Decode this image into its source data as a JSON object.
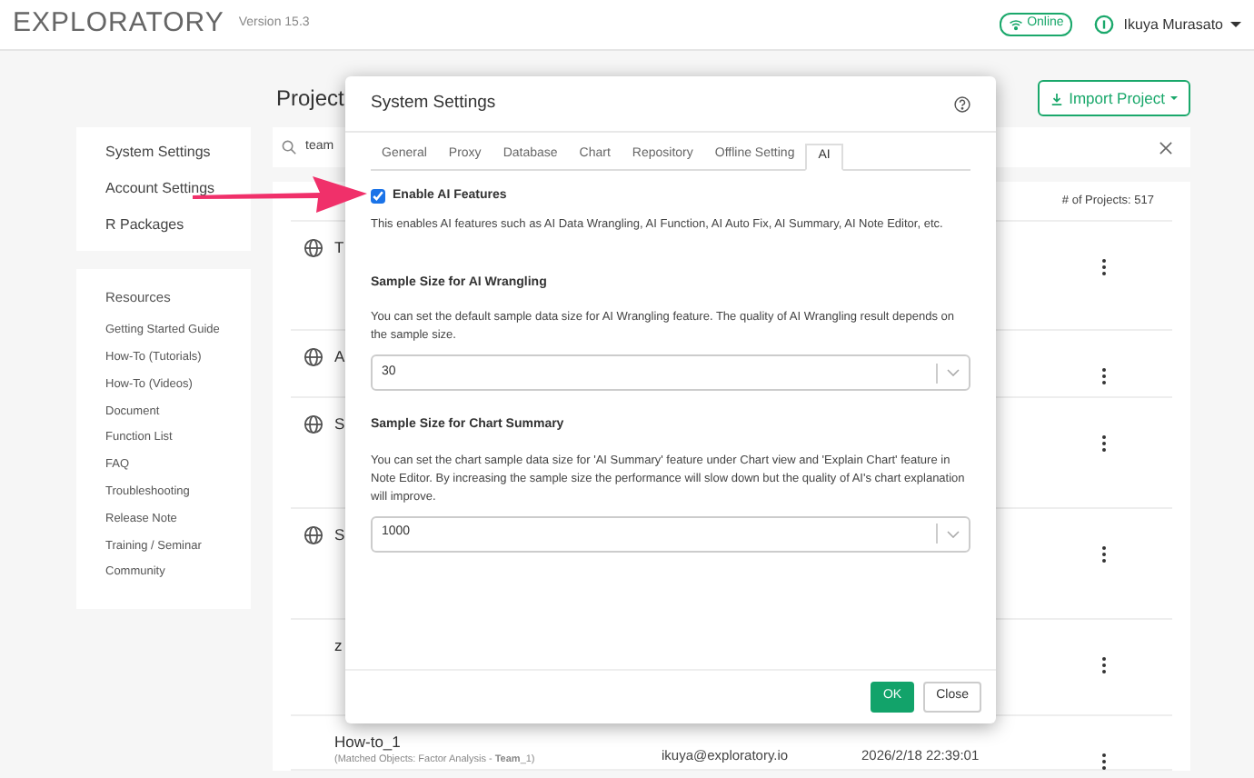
{
  "header": {
    "logo": "EXPLORATORY",
    "version": "Version 15.3",
    "status": "Online",
    "user": "Ikuya Murasato"
  },
  "settings_menu": [
    {
      "label": "System Settings"
    },
    {
      "label": "Account Settings"
    },
    {
      "label": "R Packages"
    }
  ],
  "resources": {
    "title": "Resources",
    "items": [
      "Getting Started Guide",
      "How-To (Tutorials)",
      "How-To (Videos)",
      "Document",
      "Function List",
      "FAQ",
      "Troubleshooting",
      "Release Note",
      "Training / Seminar",
      "Community"
    ]
  },
  "page": {
    "title": "Project",
    "import_button": "Import Project",
    "search": {
      "value": "team"
    },
    "project_count": "# of Projects: 517"
  },
  "projects": [
    {
      "title": "T",
      "kind": "public"
    },
    {
      "title": "A",
      "kind": "public"
    },
    {
      "title": "S",
      "kind": "public"
    },
    {
      "title": "S",
      "kind": "public"
    },
    {
      "title": "z",
      "kind": "private"
    },
    {
      "title": "How-to_1",
      "kind": "private",
      "matched": "(Matched Objects: Factor Analysis - **Team**_1)",
      "owner": "ikuya@exploratory.io",
      "updated": "2026/2/18 22:39:01"
    }
  ],
  "dialog": {
    "title": "System Settings",
    "tabs": [
      {
        "label": "General",
        "selected": false
      },
      {
        "label": "Proxy",
        "selected": false
      },
      {
        "label": "Database",
        "selected": false
      },
      {
        "label": "Chart",
        "selected": false
      },
      {
        "label": "Repository",
        "selected": false
      },
      {
        "label": "Offline Setting",
        "selected": false
      },
      {
        "label": "AI",
        "selected": true
      }
    ],
    "enable_ai": {
      "label": "Enable AI Features",
      "checked": true
    },
    "description": "This enables AI features such as AI Data Wrangling, AI Function, AI Auto Fix, AI Summary, AI Note Editor, etc.",
    "sections": [
      {
        "heading": "Sample Size for AI Wrangling",
        "description": "You can set the default sample data size for AI Wrangling feature. The quality of AI Wrangling result depends on the sample size.",
        "value": "30"
      },
      {
        "heading": "Sample Size for Chart Summary",
        "description": "You can set the chart sample data size for 'AI Summary' feature under Chart view and 'Explain Chart' feature in Note Editor. By increasing the sample size the performance will slow down but the quality of AI's chart explanation will improve.",
        "value": "1000"
      }
    ],
    "buttons": [
      {
        "label": "OK",
        "kind": "primary"
      },
      {
        "label": "Close",
        "kind": "default"
      }
    ]
  }
}
